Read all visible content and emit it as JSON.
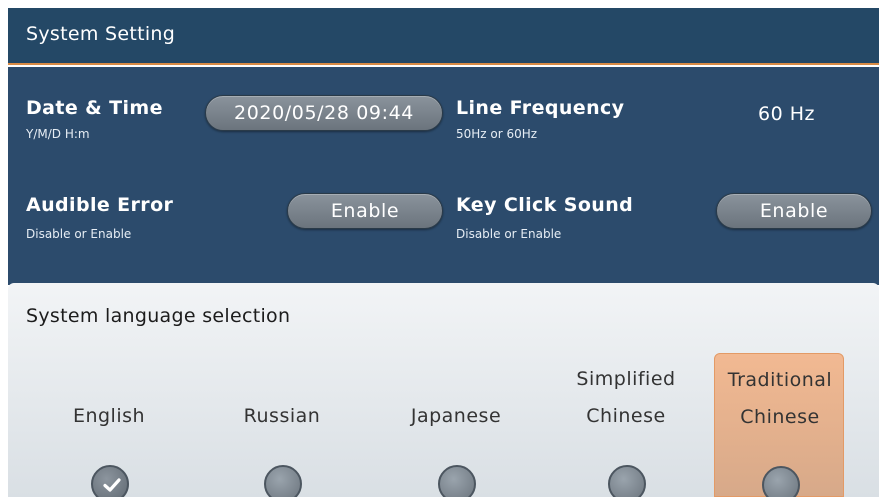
{
  "window": {
    "title": "System Setting"
  },
  "colors": {
    "header": "#244866",
    "panel": "#2c4b6c",
    "accent": "#d98b45",
    "selected_bg": "#f2b992"
  },
  "settings": {
    "date_time": {
      "label": "Date & Time",
      "sub": "Y/M/D H:m",
      "value": "2020/05/28 09:44"
    },
    "line_frequency": {
      "label": "Line Frequency",
      "sub": "50Hz or 60Hz",
      "value": "60 Hz"
    },
    "audible_error": {
      "label": "Audible Error",
      "sub": "Disable or Enable",
      "value": "Enable"
    },
    "key_click": {
      "label": "Key Click Sound",
      "sub": "Disable or Enable",
      "value": "Enable"
    }
  },
  "language": {
    "title": "System language selection",
    "options": [
      {
        "line1": "",
        "line2": "English",
        "checked": true
      },
      {
        "line1": "",
        "line2": "Russian",
        "checked": false
      },
      {
        "line1": "",
        "line2": "Japanese",
        "checked": false
      },
      {
        "line1": "Simplified",
        "line2": "Chinese",
        "checked": false
      },
      {
        "line1": "Traditional",
        "line2": "Chinese",
        "checked": false
      }
    ],
    "highlighted": "Traditional Chinese"
  },
  "icons": {
    "check": "check-icon",
    "radio": "radio-button"
  }
}
